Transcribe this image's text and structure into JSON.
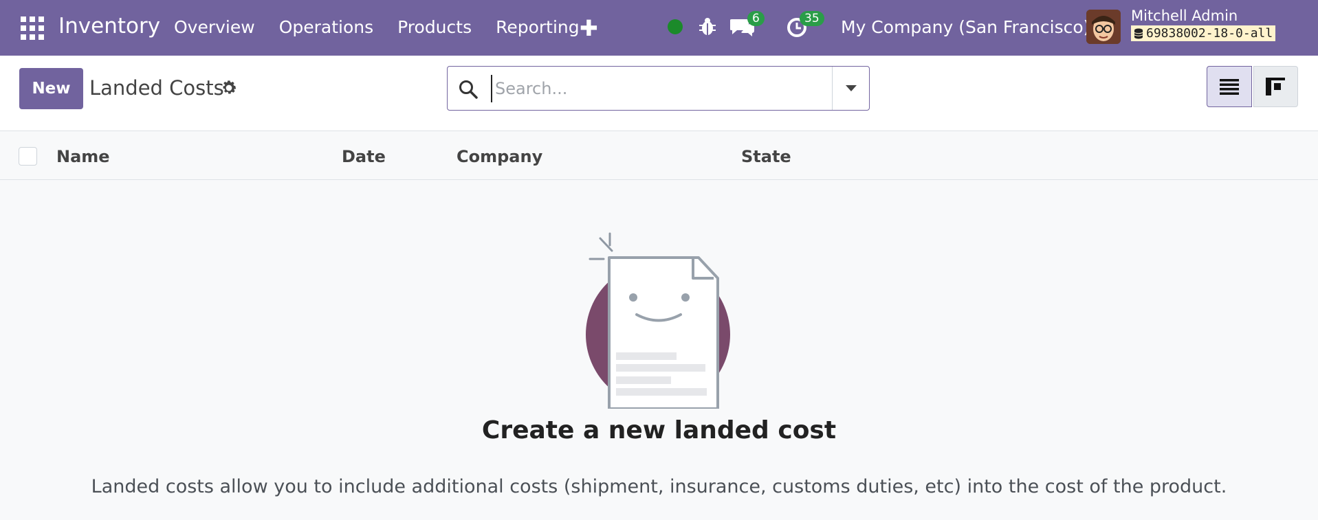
{
  "navbar": {
    "app_name": "Inventory",
    "menu": [
      {
        "label": "Overview"
      },
      {
        "label": "Operations"
      },
      {
        "label": "Products"
      },
      {
        "label": "Reporting"
      }
    ],
    "messages_count": "6",
    "activities_count": "35",
    "company": "My Company (San Francisco)",
    "user_name": "Mitchell Admin",
    "database": "69838002-18-0-all",
    "accent_color": "#71639e",
    "status_color": "#1b8a2a"
  },
  "control": {
    "new_label": "New",
    "title": "Landed Costs",
    "search_placeholder": "Search..."
  },
  "list": {
    "columns": [
      {
        "label": "Name"
      },
      {
        "label": "Date"
      },
      {
        "label": "Company"
      },
      {
        "label": "State"
      }
    ]
  },
  "empty_state": {
    "title": "Create a new landed cost",
    "description": "Landed costs allow you to include additional costs (shipment, insurance, customs duties, etc) into the cost of the product."
  },
  "icons": [
    "apps-grid-icon",
    "plus-icon",
    "bug-icon",
    "chat-icon",
    "clock-icon",
    "database-icon",
    "gear-icon",
    "search-icon",
    "caret-down-icon",
    "list-view-icon",
    "kanban-view-icon"
  ]
}
